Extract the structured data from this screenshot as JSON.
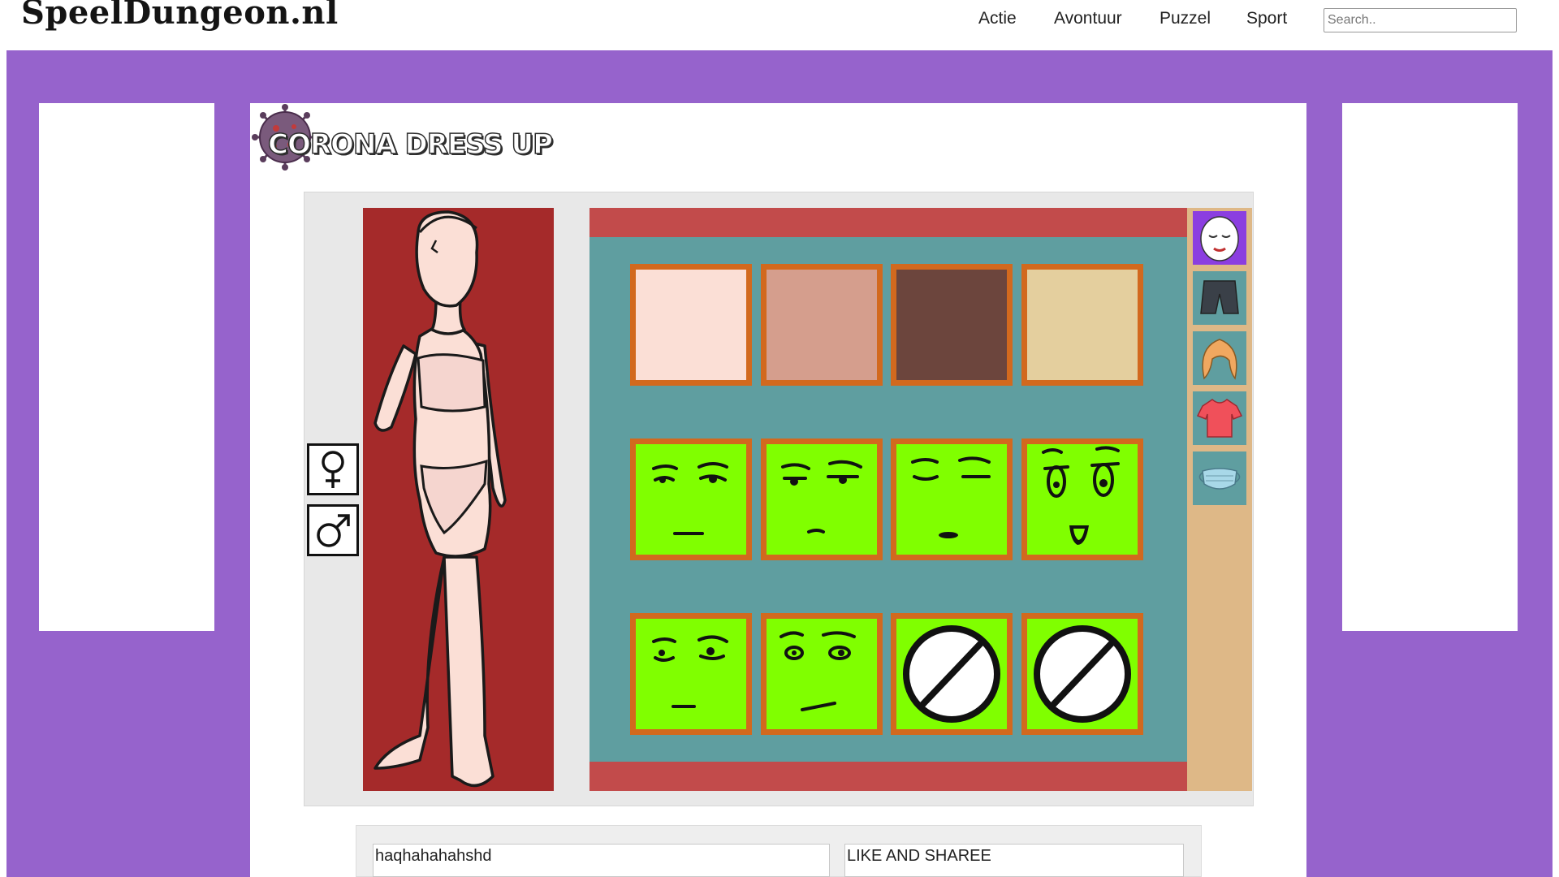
{
  "header": {
    "logo": "SpeelDungeon.nl",
    "nav": [
      "Actie",
      "Avontuur",
      "Puzzel",
      "Sport"
    ],
    "search_placeholder": "Search.."
  },
  "game": {
    "title": "CORONA DRESS UP",
    "gender_options": [
      "female-symbol-icon",
      "male-symbol-icon"
    ],
    "categories": [
      "face-mask-icon",
      "shorts-icon",
      "hair-icon",
      "shirt-icon",
      "face-covering-icon"
    ],
    "skin_colors": [
      "#fbdfd6",
      "#d59e8d",
      "#6c453d",
      "#e4cf9e"
    ],
    "face_options": [
      "face-1",
      "face-2",
      "face-3",
      "face-4",
      "face-5",
      "face-6",
      "none",
      "none"
    ],
    "colors": {
      "page_bg": "#9663cc",
      "character_bg": "#a52a2a",
      "wardrobe_bg": "#5f9ea0",
      "wardrobe_bar": "#c24b4b",
      "tile_border": "#d2691e",
      "tile_fill": "#80ff00",
      "category_column": "#deb887",
      "category_active": "#8b3ee0"
    }
  },
  "comments": [
    "haqhahahahshd",
    "LIKE AND SHAREE"
  ]
}
